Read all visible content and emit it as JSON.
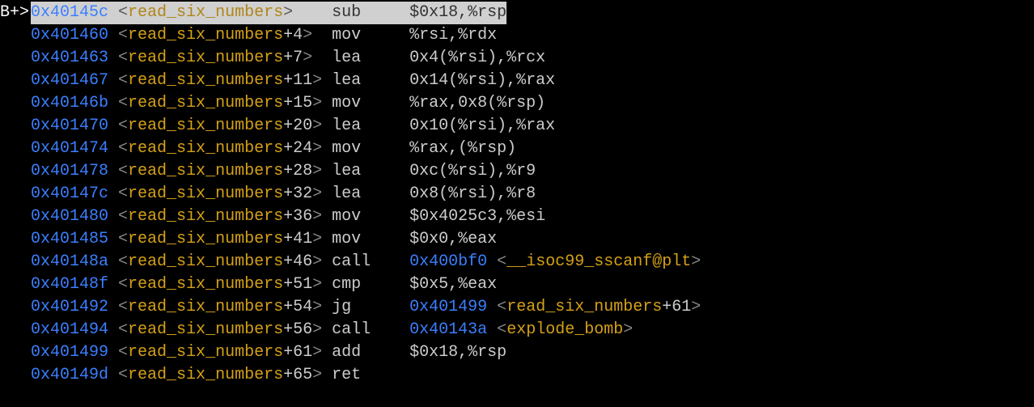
{
  "breakpoint_marker": "B+>",
  "lines": [
    {
      "marker": "B+>",
      "highlighted": true,
      "addr": "0x40145c",
      "func": "read_six_numbers",
      "offset": "",
      "mnemonic": "sub",
      "operands": "$0x18,%rsp",
      "call_target": null
    },
    {
      "marker": "",
      "highlighted": false,
      "addr": "0x401460",
      "func": "read_six_numbers",
      "offset": "+4",
      "mnemonic": "mov",
      "operands": "%rsi,%rdx",
      "call_target": null
    },
    {
      "marker": "",
      "highlighted": false,
      "addr": "0x401463",
      "func": "read_six_numbers",
      "offset": "+7",
      "mnemonic": "lea",
      "operands": "0x4(%rsi),%rcx",
      "call_target": null
    },
    {
      "marker": "",
      "highlighted": false,
      "addr": "0x401467",
      "func": "read_six_numbers",
      "offset": "+11",
      "mnemonic": "lea",
      "operands": "0x14(%rsi),%rax",
      "call_target": null
    },
    {
      "marker": "",
      "highlighted": false,
      "addr": "0x40146b",
      "func": "read_six_numbers",
      "offset": "+15",
      "mnemonic": "mov",
      "operands": "%rax,0x8(%rsp)",
      "call_target": null
    },
    {
      "marker": "",
      "highlighted": false,
      "addr": "0x401470",
      "func": "read_six_numbers",
      "offset": "+20",
      "mnemonic": "lea",
      "operands": "0x10(%rsi),%rax",
      "call_target": null
    },
    {
      "marker": "",
      "highlighted": false,
      "addr": "0x401474",
      "func": "read_six_numbers",
      "offset": "+24",
      "mnemonic": "mov",
      "operands": "%rax,(%rsp)",
      "call_target": null
    },
    {
      "marker": "",
      "highlighted": false,
      "addr": "0x401478",
      "func": "read_six_numbers",
      "offset": "+28",
      "mnemonic": "lea",
      "operands": "0xc(%rsi),%r9",
      "call_target": null
    },
    {
      "marker": "",
      "highlighted": false,
      "addr": "0x40147c",
      "func": "read_six_numbers",
      "offset": "+32",
      "mnemonic": "lea",
      "operands": "0x8(%rsi),%r8",
      "call_target": null
    },
    {
      "marker": "",
      "highlighted": false,
      "addr": "0x401480",
      "func": "read_six_numbers",
      "offset": "+36",
      "mnemonic": "mov",
      "operands": "$0x4025c3,%esi",
      "call_target": null
    },
    {
      "marker": "",
      "highlighted": false,
      "addr": "0x401485",
      "func": "read_six_numbers",
      "offset": "+41",
      "mnemonic": "mov",
      "operands": "$0x0,%eax",
      "call_target": null
    },
    {
      "marker": "",
      "highlighted": false,
      "addr": "0x40148a",
      "func": "read_six_numbers",
      "offset": "+46",
      "mnemonic": "call",
      "operands": "",
      "call_target": {
        "addr": "0x400bf0",
        "func": "__isoc99_sscanf@plt",
        "offset": ""
      }
    },
    {
      "marker": "",
      "highlighted": false,
      "addr": "0x40148f",
      "func": "read_six_numbers",
      "offset": "+51",
      "mnemonic": "cmp",
      "operands": "$0x5,%eax",
      "call_target": null
    },
    {
      "marker": "",
      "highlighted": false,
      "addr": "0x401492",
      "func": "read_six_numbers",
      "offset": "+54",
      "mnemonic": "jg",
      "operands": "",
      "call_target": {
        "addr": "0x401499",
        "func": "read_six_numbers",
        "offset": "+61"
      }
    },
    {
      "marker": "",
      "highlighted": false,
      "addr": "0x401494",
      "func": "read_six_numbers",
      "offset": "+56",
      "mnemonic": "call",
      "operands": "",
      "call_target": {
        "addr": "0x40143a",
        "func": "explode_bomb",
        "offset": ""
      }
    },
    {
      "marker": "",
      "highlighted": false,
      "addr": "0x401499",
      "func": "read_six_numbers",
      "offset": "+61",
      "mnemonic": "add",
      "operands": "$0x18,%rsp",
      "call_target": null
    },
    {
      "marker": "",
      "highlighted": false,
      "addr": "0x40149d",
      "func": "read_six_numbers",
      "offset": "+65",
      "mnemonic": "ret",
      "operands": "",
      "call_target": null
    }
  ]
}
